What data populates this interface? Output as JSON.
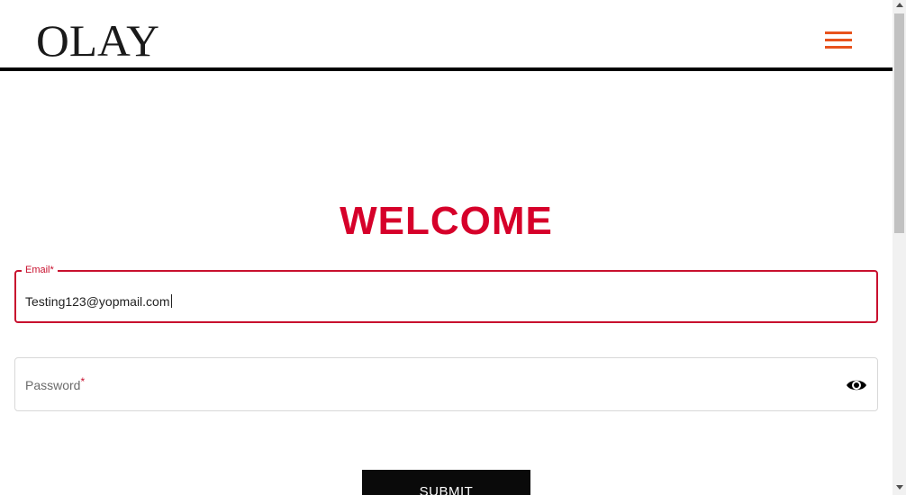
{
  "colors": {
    "brand_red": "#c8102e",
    "heading_red": "#d6002a",
    "menu_orange": "#e8531d",
    "text_dark": "#222222",
    "label_gray": "#6b6b6b",
    "button_black": "#0a0a0a"
  },
  "header": {
    "logo_text": "OLAY",
    "menu_icon": "hamburger-menu-icon"
  },
  "main": {
    "heading": "WELCOME",
    "email": {
      "label": "Email",
      "required_mark": "*",
      "value": "Testing123@yopmail.com"
    },
    "password": {
      "label": "Password",
      "required_mark": "*",
      "value": "",
      "toggle_icon": "eye-icon"
    },
    "submit_label": "SUBMIT"
  }
}
